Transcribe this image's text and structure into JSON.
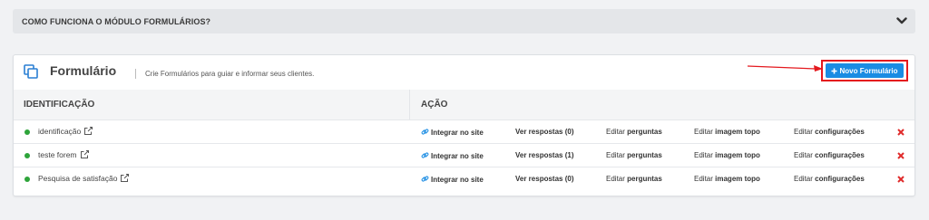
{
  "faq": {
    "title": "COMO FUNCIONA O MÓDULO FORMULÁRIOS?"
  },
  "header": {
    "title": "Formulário",
    "subtitle": "Crie Formulários para guiar e informar seus clientes.",
    "new_button": "Novo Formulário"
  },
  "table": {
    "col_identificacao": "IDENTIFICAÇÃO",
    "col_acao": "AÇÃO",
    "rows": [
      {
        "name": "identificação",
        "integrar": "Integrar no site",
        "respostas": "Ver respostas (0)",
        "editar": "Editar",
        "perguntas": "perguntas",
        "imagem": "imagem topo",
        "configuracoes": "configurações"
      },
      {
        "name": "teste forem",
        "integrar": "Integrar no site",
        "respostas": "Ver respostas (1)",
        "editar": "Editar",
        "perguntas": "perguntas",
        "imagem": "imagem topo",
        "configuracoes": "configurações"
      },
      {
        "name": "Pesquisa de satisfação",
        "integrar": "Integrar no site",
        "respostas": "Ver respostas (0)",
        "editar": "Editar",
        "perguntas": "perguntas",
        "imagem": "imagem topo",
        "configuracoes": "configurações"
      }
    ]
  },
  "colors": {
    "accent": "#1a8ce3",
    "status_active": "#2ea43a",
    "delete": "#e02b2b",
    "highlight": "#e4191e"
  },
  "icons": [
    "chevron-down-icon",
    "copy-icon",
    "plus-icon",
    "external-link-icon",
    "link-icon",
    "close-icon"
  ]
}
